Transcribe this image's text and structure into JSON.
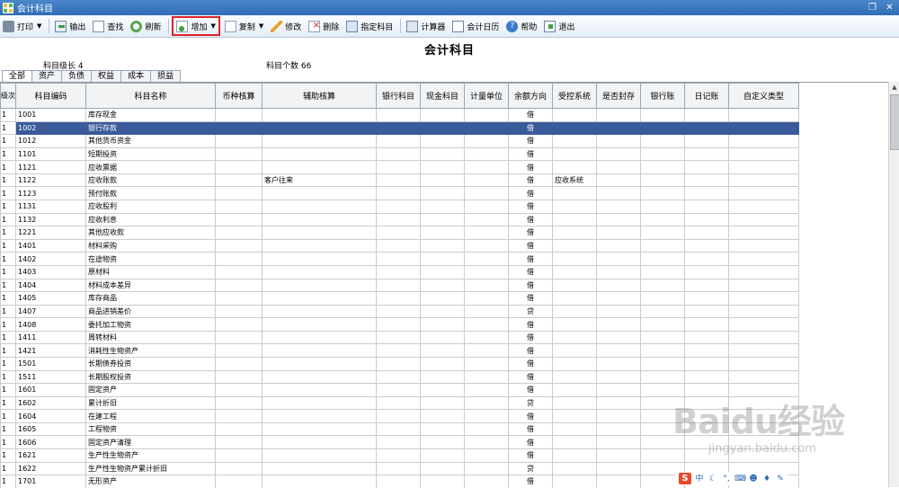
{
  "window": {
    "title": "会计科目"
  },
  "toolbar": {
    "print": "打印",
    "export": "输出",
    "find": "查找",
    "refresh": "刷新",
    "add": "增加",
    "copy": "复制",
    "edit": "修改",
    "delete": "删除",
    "assign": "指定科目",
    "calculator": "计算器",
    "calendar": "会计日历",
    "help": "帮助",
    "exit": "退出"
  },
  "page": {
    "title": "会计科目",
    "level_label": "科目级长",
    "level_value": "4",
    "count_label": "科目个数",
    "count_value": "66"
  },
  "tabs": [
    "全部",
    "资产",
    "负债",
    "权益",
    "成本",
    "损益"
  ],
  "grid": {
    "columns": [
      "级次",
      "科目编码",
      "科目名称",
      "币种核算",
      "辅助核算",
      "银行科目",
      "现金科目",
      "计量单位",
      "余额方向",
      "受控系统",
      "是否封存",
      "银行账",
      "日记账",
      "自定义类型"
    ],
    "selected_row": 1,
    "rows": [
      {
        "level": "1",
        "code": "1001",
        "name": "库存现金",
        "aux": "",
        "dir": "借",
        "ctrl": ""
      },
      {
        "level": "1",
        "code": "1002",
        "name": "银行存款",
        "aux": "",
        "dir": "借",
        "ctrl": ""
      },
      {
        "level": "1",
        "code": "1012",
        "name": "其他货币资金",
        "aux": "",
        "dir": "借",
        "ctrl": ""
      },
      {
        "level": "1",
        "code": "1101",
        "name": "短期投资",
        "aux": "",
        "dir": "借",
        "ctrl": ""
      },
      {
        "level": "1",
        "code": "1121",
        "name": "应收票据",
        "aux": "",
        "dir": "借",
        "ctrl": ""
      },
      {
        "level": "1",
        "code": "1122",
        "name": "应收账款",
        "aux": "客户往来",
        "dir": "借",
        "ctrl": "应收系统"
      },
      {
        "level": "1",
        "code": "1123",
        "name": "预付账款",
        "aux": "",
        "dir": "借",
        "ctrl": ""
      },
      {
        "level": "1",
        "code": "1131",
        "name": "应收股利",
        "aux": "",
        "dir": "借",
        "ctrl": ""
      },
      {
        "level": "1",
        "code": "1132",
        "name": "应收利息",
        "aux": "",
        "dir": "借",
        "ctrl": ""
      },
      {
        "level": "1",
        "code": "1221",
        "name": "其他应收款",
        "aux": "",
        "dir": "借",
        "ctrl": ""
      },
      {
        "level": "1",
        "code": "1401",
        "name": "材料采购",
        "aux": "",
        "dir": "借",
        "ctrl": ""
      },
      {
        "level": "1",
        "code": "1402",
        "name": "在途物资",
        "aux": "",
        "dir": "借",
        "ctrl": ""
      },
      {
        "level": "1",
        "code": "1403",
        "name": "原材料",
        "aux": "",
        "dir": "借",
        "ctrl": ""
      },
      {
        "level": "1",
        "code": "1404",
        "name": "材料成本差异",
        "aux": "",
        "dir": "借",
        "ctrl": ""
      },
      {
        "level": "1",
        "code": "1405",
        "name": "库存商品",
        "aux": "",
        "dir": "借",
        "ctrl": ""
      },
      {
        "level": "1",
        "code": "1407",
        "name": "商品进销差价",
        "aux": "",
        "dir": "贷",
        "ctrl": ""
      },
      {
        "level": "1",
        "code": "1408",
        "name": "委托加工物资",
        "aux": "",
        "dir": "借",
        "ctrl": ""
      },
      {
        "level": "1",
        "code": "1411",
        "name": "周转材料",
        "aux": "",
        "dir": "借",
        "ctrl": ""
      },
      {
        "level": "1",
        "code": "1421",
        "name": "消耗性生物资产",
        "aux": "",
        "dir": "借",
        "ctrl": ""
      },
      {
        "level": "1",
        "code": "1501",
        "name": "长期债券投资",
        "aux": "",
        "dir": "借",
        "ctrl": ""
      },
      {
        "level": "1",
        "code": "1511",
        "name": "长期股权投资",
        "aux": "",
        "dir": "借",
        "ctrl": ""
      },
      {
        "level": "1",
        "code": "1601",
        "name": "固定资产",
        "aux": "",
        "dir": "借",
        "ctrl": ""
      },
      {
        "level": "1",
        "code": "1602",
        "name": "累计折旧",
        "aux": "",
        "dir": "贷",
        "ctrl": ""
      },
      {
        "level": "1",
        "code": "1604",
        "name": "在建工程",
        "aux": "",
        "dir": "借",
        "ctrl": ""
      },
      {
        "level": "1",
        "code": "1605",
        "name": "工程物资",
        "aux": "",
        "dir": "借",
        "ctrl": ""
      },
      {
        "level": "1",
        "code": "1606",
        "name": "固定资产清理",
        "aux": "",
        "dir": "借",
        "ctrl": ""
      },
      {
        "level": "1",
        "code": "1621",
        "name": "生产性生物资产",
        "aux": "",
        "dir": "借",
        "ctrl": ""
      },
      {
        "level": "1",
        "code": "1622",
        "name": "生产性生物资产累计折旧",
        "aux": "",
        "dir": "贷",
        "ctrl": ""
      },
      {
        "level": "1",
        "code": "1701",
        "name": "无形资产",
        "aux": "",
        "dir": "借",
        "ctrl": ""
      }
    ]
  },
  "ime": {
    "logo": "S",
    "mode": "中"
  },
  "watermark": {
    "brand": "Baidu经验",
    "url": "jingyan.baidu.com"
  },
  "colors": {
    "selected_row": "#3a5a9a",
    "titlebar": "#2f6db5",
    "highlight_box": "#e0232a"
  }
}
